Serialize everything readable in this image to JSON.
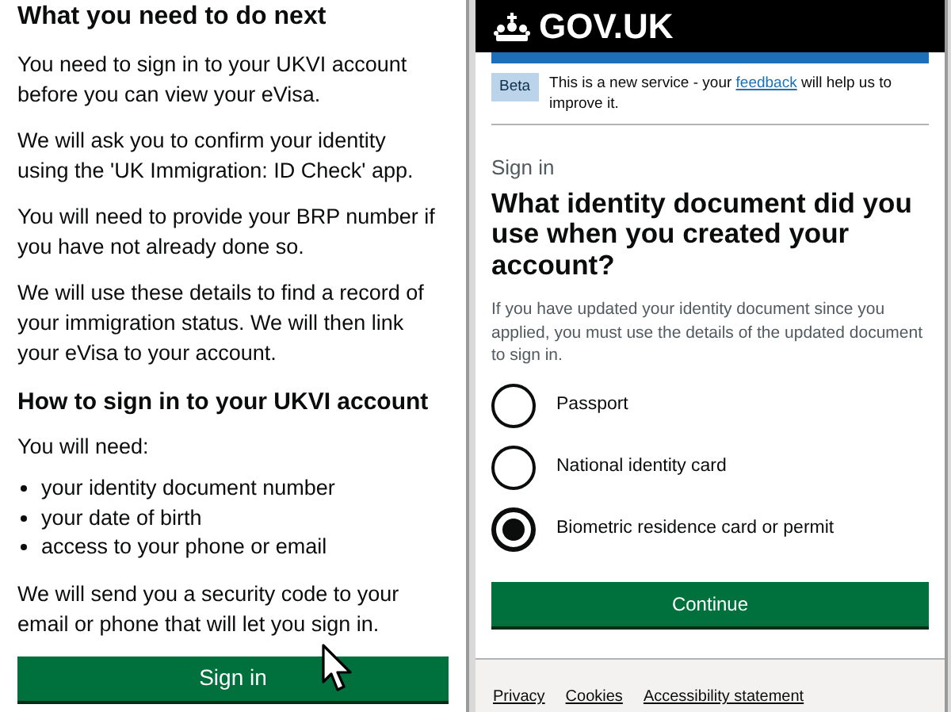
{
  "left_screen": {
    "heading": "What you need to do next",
    "paragraphs": [
      "You need to sign in to your UKVI account before you can view your eVisa.",
      "We will ask you to confirm your identity using the 'UK Immigration: ID Check' app.",
      "You will need to provide your BRP number if you have not already done so.",
      "We will use these details to find a record of your immigration status. We will then link your eVisa to your account."
    ],
    "subheading": "How to sign in to your UKVI account",
    "intro": "You will need:",
    "bullets": [
      "your identity document number",
      "your date of birth",
      "access to your phone or email"
    ],
    "closing": "We will send you a security code to your email or phone that will let you sign in.",
    "button": "Sign in"
  },
  "right_screen": {
    "header": {
      "logo_text": "GOV.UK"
    },
    "banner": {
      "tag": "Beta",
      "before": "This is a new service - your ",
      "link": "feedback",
      "after": " will help us to improve it."
    },
    "caption": "Sign in",
    "question": "What identity document did you use when you created your account?",
    "hint": "If you have updated your identity document since you applied, you must use the details of the updated document to sign in.",
    "options": [
      {
        "label": "Passport",
        "selected": false
      },
      {
        "label": "National identity card",
        "selected": false
      },
      {
        "label": "Biometric residence card or permit",
        "selected": true
      }
    ],
    "button": "Continue",
    "footer_links": [
      "Privacy",
      "Cookies",
      "Accessibility statement"
    ]
  }
}
